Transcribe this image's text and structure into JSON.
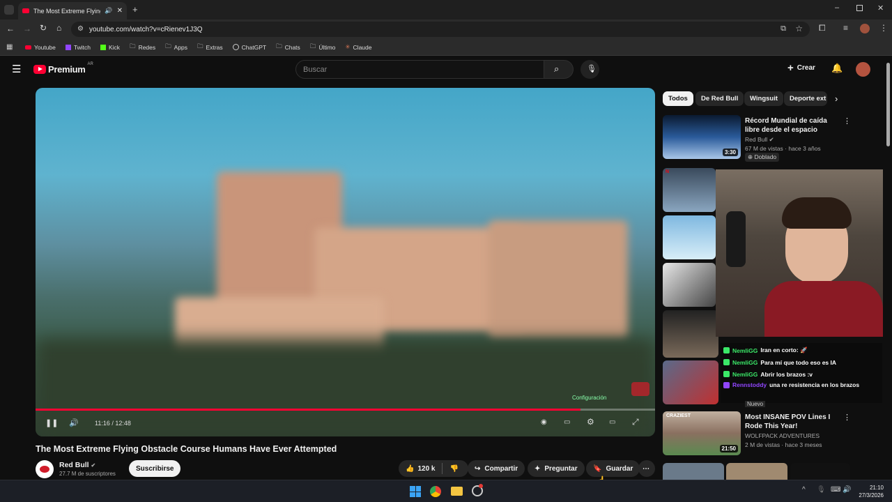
{
  "browser": {
    "tab_title": "The Most Extreme Flying Ob",
    "url": "youtube.com/watch?v=cRienev1J3Q",
    "bookmarks": [
      "Youtube",
      "Twitch",
      "Kick",
      "Redes",
      "Apps",
      "Extras",
      "ChatGPT",
      "Chats",
      "Último",
      "Claude"
    ]
  },
  "masthead": {
    "logo_text": "Premium",
    "region": "AR",
    "search_placeholder": "Buscar",
    "create_label": "Crear"
  },
  "player": {
    "time": "11:16 / 12:48",
    "progress": 0.88,
    "overlay_text": "Configuración"
  },
  "video": {
    "title": "The Most Extreme Flying Obstacle Course Humans Have Ever Attempted",
    "channel": "Red Bull",
    "subscribers": "27.7 M de suscriptores",
    "subscribe_label": "Suscribirse",
    "likes": "120 k",
    "share_label": "Compartir",
    "ask_label": "Preguntar",
    "save_label": "Guardar"
  },
  "chips": [
    "Todos",
    "De Red Bull",
    "Wingsuit",
    "Deporte ext"
  ],
  "recommendations": [
    {
      "title": "Récord Mundial de caída libre desde el espacio",
      "channel": "Red Bull",
      "meta": "67 M de vistas · hace 3 años",
      "badge": "Doblado",
      "duration": "3:30"
    },
    {
      "title": "Most INSANE POV Lines I Rode This Year!",
      "channel": "WOLFPACK ADVENTURES",
      "meta": "2 M de vistas · hace 3 meses",
      "badge": "Nuevo",
      "duration": "21:50",
      "thumb_text": "CRAZIEST"
    }
  ],
  "chat": [
    {
      "user": "NemliGG",
      "msg": "Iran en corto: 🚀"
    },
    {
      "user": "NemliGG",
      "msg": "Para mí que todo eso es IA"
    },
    {
      "user": "NemliGG",
      "msg": "Abrir los brazos :v"
    },
    {
      "user": "Rennstoddy",
      "msg": "una re resistencia en los brazos"
    }
  ],
  "taskbar": {
    "time": "21:10",
    "date": "27/3/2026"
  },
  "colors": {
    "accent_red": "#ff0033",
    "chat_green": "#3be868",
    "chat_purple": "#9146ff"
  }
}
